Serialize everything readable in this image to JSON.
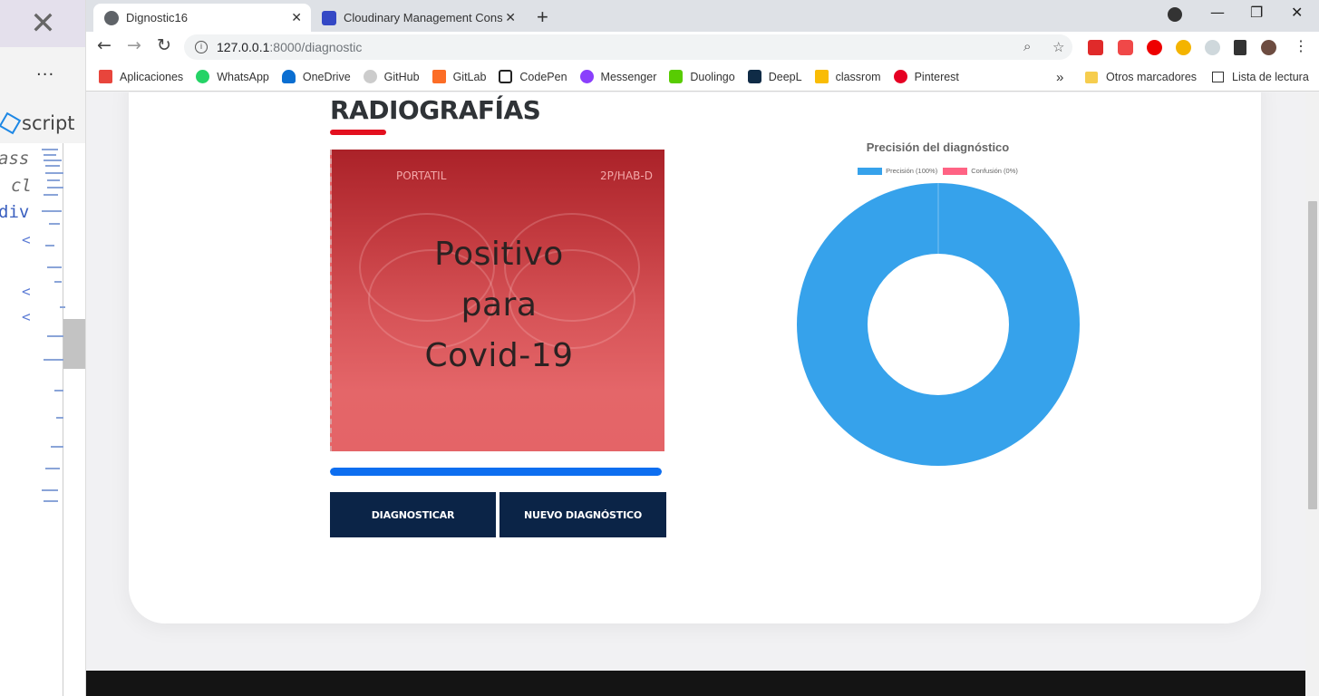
{
  "browser": {
    "tabs": [
      {
        "title": "Dignostic16",
        "active": true
      },
      {
        "title": "Cloudinary Management Console",
        "active": false
      }
    ],
    "url_host": "127.0.0.1",
    "url_path": ":8000/diagnostic",
    "bookmarks": [
      "Aplicaciones",
      "WhatsApp",
      "OneDrive",
      "GitHub",
      "GitLab",
      "CodePen",
      "Messenger",
      "Duolingo",
      "DeepL",
      "classrom",
      "Pinterest"
    ],
    "bookmark_overflow": "»",
    "other_bookmarks": "Otros marcadores",
    "reading_list": "Lista de lectura"
  },
  "editor": {
    "tab_label": "script",
    "code_lines": [
      "ass",
      "cl",
      "div"
    ]
  },
  "page": {
    "heading": "DIAGNÓSTICO BASADO EN RADIOGRAFÍAS",
    "image_labels": {
      "left": "PORTATIL",
      "right": "2P/HAB-D"
    },
    "result_lines": [
      "Positivo",
      "para",
      "Covid-19"
    ],
    "progress_percent": 100,
    "buttons": {
      "diagnose": "DIAGNOSTICAR",
      "new": "NUEVO DIAGNÓSTICO"
    }
  },
  "colors": {
    "precision": "#36a2eb",
    "confusion": "#ff6384",
    "button": "#0b2447",
    "underline": "#e3101f",
    "progress": "#0d6ef0"
  },
  "chart_data": {
    "type": "pie",
    "variant": "doughnut",
    "title": "Precisión del diagnóstico",
    "categories": [
      "Precisión (100%)",
      "Confusión (0%)"
    ],
    "values": [
      100,
      0
    ],
    "legend": "top"
  }
}
